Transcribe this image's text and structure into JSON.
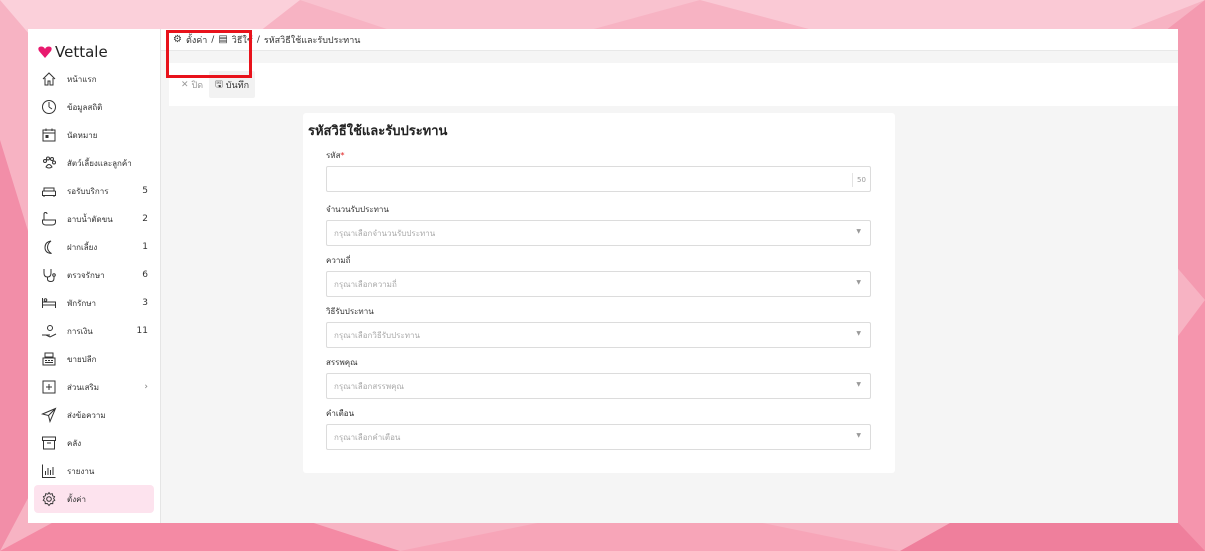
{
  "app": {
    "logo_text": "Vettale"
  },
  "breadcrumb": {
    "settings": "ตั้งค่า",
    "sep1": "/",
    "methods": "วิธีใช้",
    "sep2": "/",
    "current": "รหัสวิธีใช้และรับประทาน"
  },
  "toolbar": {
    "cancel_label": "ปิด",
    "save_label": "บันทึก"
  },
  "sidebar": {
    "items": [
      {
        "label": "หน้าแรก",
        "count": ""
      },
      {
        "label": "ข้อมูลสถิติ",
        "count": ""
      },
      {
        "label": "นัดหมาย",
        "count": ""
      },
      {
        "label": "สัตว์เลี้ยงและลูกค้า",
        "count": ""
      },
      {
        "label": "รอรับบริการ",
        "count": "5"
      },
      {
        "label": "อาบน้ำตัดขน",
        "count": "2"
      },
      {
        "label": "ฝากเลี้ยง",
        "count": "1"
      },
      {
        "label": "ตรวจรักษา",
        "count": "6"
      },
      {
        "label": "พักรักษา",
        "count": "3"
      },
      {
        "label": "การเงิน",
        "count": "11"
      },
      {
        "label": "ขายปลีก",
        "count": ""
      },
      {
        "label": "ส่วนเสริม",
        "count": ""
      },
      {
        "label": "ส่งข้อความ",
        "count": ""
      },
      {
        "label": "คลัง",
        "count": ""
      },
      {
        "label": "รายงาน",
        "count": ""
      },
      {
        "label": "ตั้งค่า",
        "count": ""
      }
    ]
  },
  "form": {
    "title": "รหัสวิธีใช้และรับประทาน",
    "code": {
      "label": "รหัส",
      "required_mark": "*",
      "value": "",
      "counter": "50"
    },
    "amount": {
      "label": "จำนวนรับประทาน",
      "placeholder": "กรุณาเลือกจำนวนรับประทาน"
    },
    "frequency": {
      "label": "ความถี่",
      "placeholder": "กรุณาเลือกความถี่"
    },
    "method": {
      "label": "วิธีรับประทาน",
      "placeholder": "กรุณาเลือกวิธีรับประทาน"
    },
    "property": {
      "label": "สรรพคุณ",
      "placeholder": "กรุณาเลือกสรรพคุณ"
    },
    "warning": {
      "label": "คำเตือน",
      "placeholder": "กรุณาเลือกคำเตือน"
    }
  },
  "colors": {
    "accent": "#e8196e",
    "highlight": "#e8121b",
    "active_bg": "#fde3ee"
  }
}
